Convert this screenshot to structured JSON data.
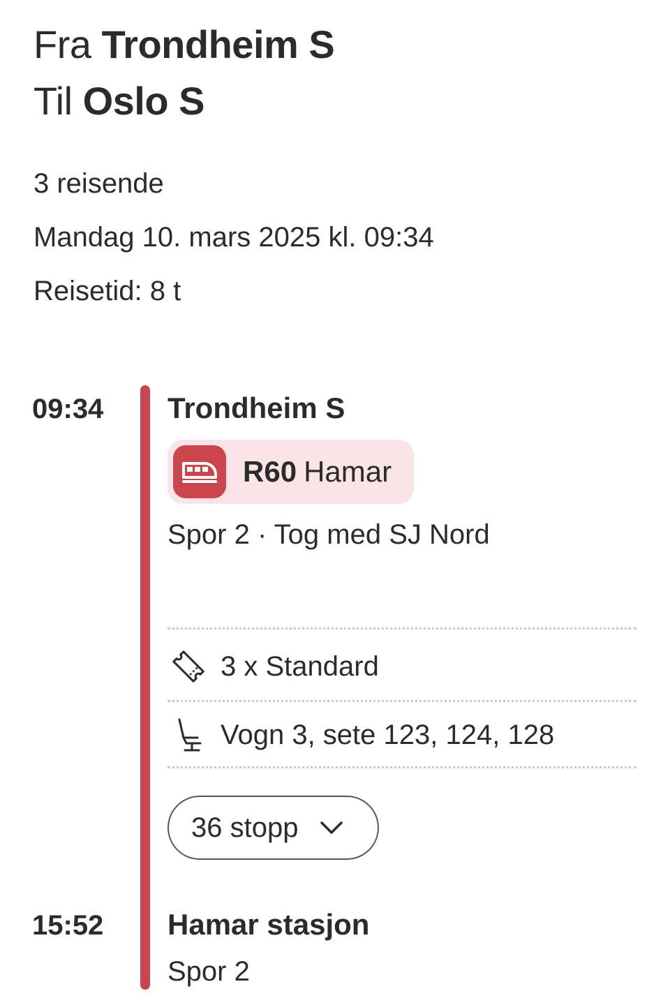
{
  "route": {
    "from_label": "Fra",
    "from_station": "Trondheim S",
    "to_label": "Til",
    "to_station": "Oslo S"
  },
  "meta": {
    "travellers": "3 reisende",
    "datetime": "Mandag 10. mars 2025 kl. 09:34",
    "duration": "Reisetid: 8 t"
  },
  "departure": {
    "time": "09:34",
    "station": "Trondheim S",
    "line_code": "R60",
    "line_destination": "Hamar",
    "platform_info": "Spor 2 · Tog med SJ Nord"
  },
  "ticket": {
    "summary": "3 x Standard",
    "seats": "Vogn 3, sete 123, 124, 128"
  },
  "stops_button": {
    "label": "36 stopp"
  },
  "arrival": {
    "time": "15:52",
    "station": "Hamar stasjon",
    "platform": "Spor 2"
  },
  "colors": {
    "accent": "#c9464f",
    "chip_background": "#fbe4e7",
    "text": "#2b2b2b"
  },
  "icons": {
    "train": "train-icon",
    "ticket": "ticket-icon",
    "seat": "seat-icon",
    "chevron": "chevron-down-icon"
  }
}
